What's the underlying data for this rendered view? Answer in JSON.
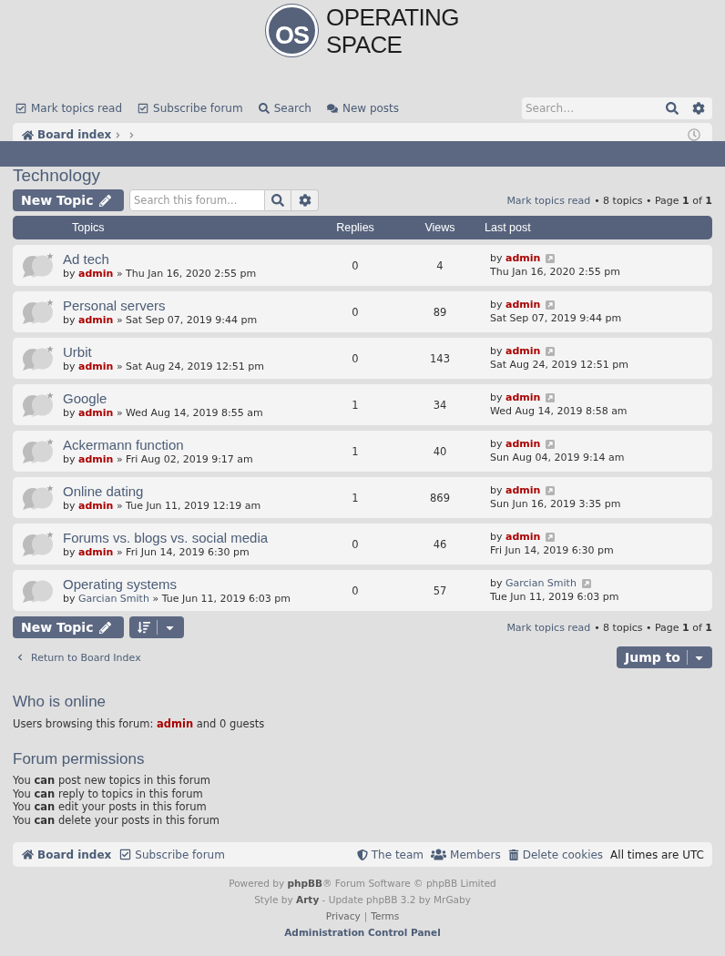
{
  "header": {
    "logo_mark": "OS",
    "site_name_lines": [
      "OPERATING",
      "SPACE"
    ]
  },
  "nav": {
    "links": [
      {
        "kind": "check",
        "label": "Mark topics read"
      },
      {
        "kind": "check",
        "label": "Subscribe forum"
      },
      {
        "kind": "search",
        "label": "Search"
      },
      {
        "kind": "posts",
        "label": "New posts"
      }
    ],
    "search": {
      "placeholder": "Search…"
    }
  },
  "breadcrumbs": [
    {
      "kind": "home",
      "label": "Board index"
    }
  ],
  "forum": {
    "title": "Technology"
  },
  "action_bar_top": {
    "new_topic": "New Topic",
    "search": {
      "placeholder": "Search this forum…"
    },
    "mark_read": "Mark topics read",
    "summary": "• 8 topics • Page **1** of **1**"
  },
  "topics": {
    "columns": [
      "Topics",
      "Replies",
      "Views",
      "Last post"
    ],
    "rows": [
      {
        "title": "Ad tech",
        "posted": true,
        "byline": {
          "prefix": "by",
          "author": {
            "name": "admin",
            "color": "#aa0000"
          },
          "separator": "»",
          "date": "Thu Jan 16, 2020 2:55 pm"
        },
        "replies": "0",
        "views": "4",
        "last_post": {
          "prefix": "by",
          "author": {
            "name": "admin",
            "color": "#aa0000"
          },
          "date": "Thu Jan 16, 2020 2:55 pm"
        }
      },
      {
        "title": "Personal servers",
        "posted": true,
        "byline": {
          "prefix": "by",
          "author": {
            "name": "admin",
            "color": "#aa0000"
          },
          "separator": "»",
          "date": "Sat Sep 07, 2019 9:44 pm"
        },
        "replies": "0",
        "views": "89",
        "last_post": {
          "prefix": "by",
          "author": {
            "name": "admin",
            "color": "#aa0000"
          },
          "date": "Sat Sep 07, 2019 9:44 pm"
        }
      },
      {
        "title": "Urbit",
        "posted": true,
        "byline": {
          "prefix": "by",
          "author": {
            "name": "admin",
            "color": "#aa0000"
          },
          "separator": "»",
          "date": "Sat Aug 24, 2019 12:51 pm"
        },
        "replies": "0",
        "views": "143",
        "last_post": {
          "prefix": "by",
          "author": {
            "name": "admin",
            "color": "#aa0000"
          },
          "date": "Sat Aug 24, 2019 12:51 pm"
        }
      },
      {
        "title": "Google",
        "posted": true,
        "byline": {
          "prefix": "by",
          "author": {
            "name": "admin",
            "color": "#aa0000"
          },
          "separator": "»",
          "date": "Wed Aug 14, 2019 8:55 am"
        },
        "replies": "1",
        "views": "34",
        "last_post": {
          "prefix": "by",
          "author": {
            "name": "admin",
            "color": "#aa0000"
          },
          "date": "Wed Aug 14, 2019 8:58 am"
        }
      },
      {
        "title": "Ackermann function",
        "posted": true,
        "byline": {
          "prefix": "by",
          "author": {
            "name": "admin",
            "color": "#aa0000"
          },
          "separator": "»",
          "date": "Fri Aug 02, 2019 9:17 am"
        },
        "replies": "1",
        "views": "40",
        "last_post": {
          "prefix": "by",
          "author": {
            "name": "admin",
            "color": "#aa0000"
          },
          "date": "Sun Aug 04, 2019 9:14 am"
        }
      },
      {
        "title": "Online dating",
        "posted": true,
        "byline": {
          "prefix": "by",
          "author": {
            "name": "admin",
            "color": "#aa0000"
          },
          "separator": "»",
          "date": "Tue Jun 11, 2019 12:19 am"
        },
        "replies": "1",
        "views": "869",
        "last_post": {
          "prefix": "by",
          "author": {
            "name": "admin",
            "color": "#aa0000"
          },
          "date": "Sun Jun 16, 2019 3:35 pm"
        }
      },
      {
        "title": "Forums vs. blogs vs. social media",
        "posted": true,
        "byline": {
          "prefix": "by",
          "author": {
            "name": "admin",
            "color": "#aa0000"
          },
          "separator": "»",
          "date": "Fri Jun 14, 2019 6:30 pm"
        },
        "replies": "0",
        "views": "46",
        "last_post": {
          "prefix": "by",
          "author": {
            "name": "admin",
            "color": "#aa0000"
          },
          "date": "Fri Jun 14, 2019 6:30 pm"
        }
      },
      {
        "title": "Operating systems",
        "posted": false,
        "byline": {
          "prefix": "by",
          "author": {
            "name": "Garcian Smith"
          },
          "separator": "»",
          "date": "Tue Jun 11, 2019 6:03 pm"
        },
        "replies": "0",
        "views": "57",
        "last_post": {
          "prefix": "by",
          "author": {
            "name": "Garcian Smith"
          },
          "date": "Tue Jun 11, 2019 6:03 pm"
        }
      }
    ]
  },
  "action_bar_bottom": {
    "new_topic": "New Topic",
    "mark_read": "Mark topics read",
    "summary": "• 8 topics • Page **1** of **1**"
  },
  "return_link": "Return to Board Index",
  "jump_to": "Jump to",
  "who_is_online": {
    "title": "Who is online",
    "prefix": "Users browsing this forum:",
    "users": [
      {
        "name": "admin",
        "color": "#aa0000"
      }
    ],
    "suffix": "and 0 guests"
  },
  "permissions": {
    "title": "Forum permissions",
    "lines": [
      "You **can** post new topics in this forum",
      "You **can** reply to topics in this forum",
      "You **can** edit your posts in this forum",
      "You **can** delete your posts in this forum"
    ]
  },
  "footer_nav": {
    "left": [
      {
        "kind": "home",
        "label": "Board index"
      },
      {
        "kind": "check",
        "label": "Subscribe forum"
      }
    ],
    "right": [
      {
        "kind": "team",
        "label": "The team"
      },
      {
        "kind": "members",
        "label": "Members"
      },
      {
        "kind": "cookies",
        "label": "Delete cookies"
      }
    ],
    "timezone": "All times are UTC"
  },
  "copyright": {
    "lines": [
      [
        {
          "kind": "text",
          "text": "Powered by "
        },
        {
          "kind": "link",
          "text": "phpBB"
        },
        {
          "kind": "text",
          "text": "® Forum Software © phpBB Limited"
        }
      ],
      [
        {
          "kind": "text",
          "text": "Style by "
        },
        {
          "kind": "link",
          "text": "Arty"
        },
        {
          "kind": "text",
          "text": " - Update phpBB 3.2 by MrGaby"
        }
      ]
    ],
    "policy_links": [
      "Privacy",
      "Terms"
    ],
    "separator": "|",
    "admin_link": "Administration Control Panel"
  }
}
